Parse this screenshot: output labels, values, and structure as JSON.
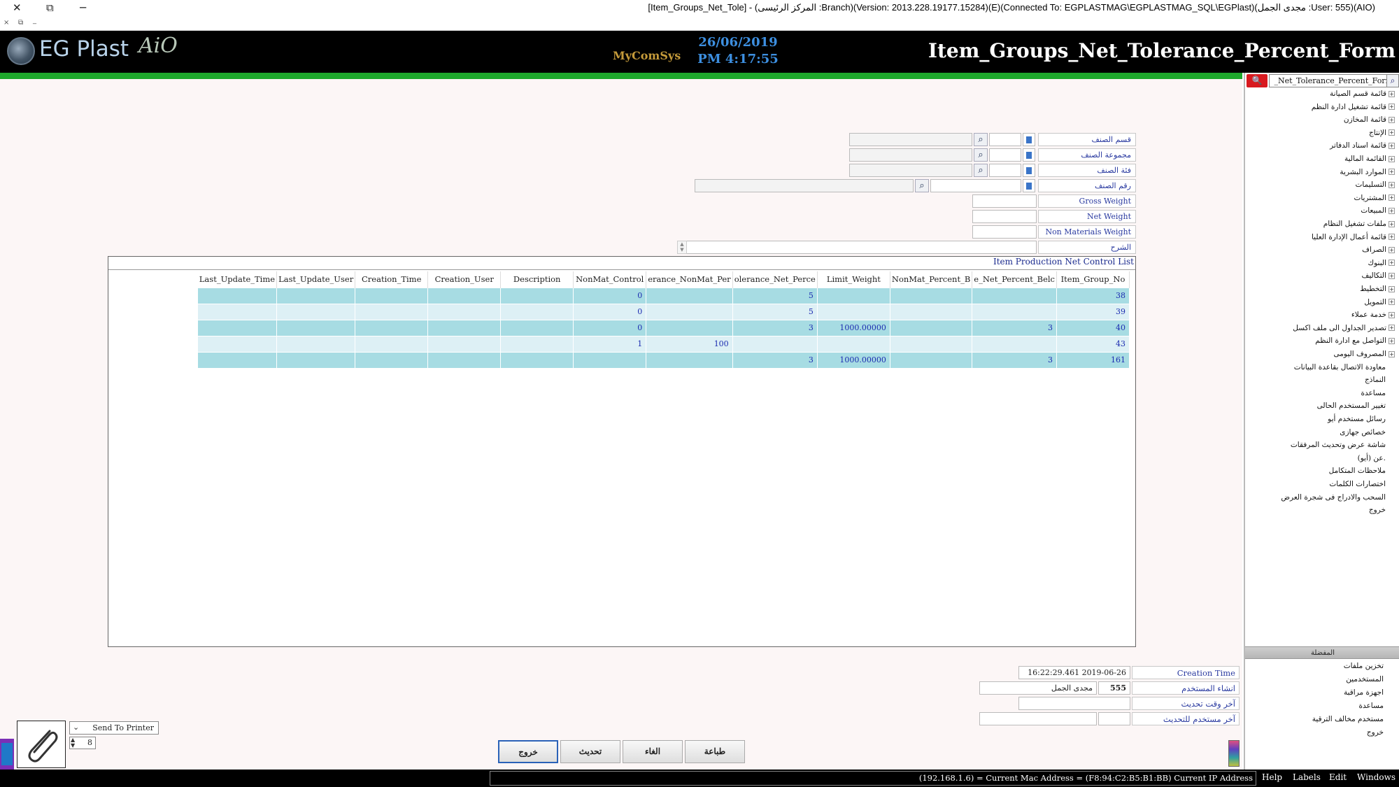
{
  "window": {
    "title": "[Item_Groups_Net_Tole] - (المركز الرئيسى :Branch)(Version: 2013.228.19177.15284)(E)(Connected To: EGPLASTMAG\\EGPLASTMAG_SQL\\EGPlast)(مجدى الجمل :User: 555)(AIO)",
    "close_glyph": "✕",
    "restore_glyph": "⧉",
    "minimize_glyph": "─",
    "sub_close": "×",
    "sub_restore": "⧉",
    "sub_minimize": "_"
  },
  "header": {
    "logo_text": "EG Plast",
    "logo_suffix": "AiO",
    "partner_logo": "MyComSys",
    "date": "26/06/2019",
    "time": "PM 4:17:55",
    "form_title": "Item_Groups_Net_Tolerance_Percent_Form"
  },
  "filters": {
    "section_label": "قسم الصنف",
    "group_label": "مجموعة الصنف",
    "category_label": "فئة الصنف",
    "item_no_label": "رقم الصنف",
    "gross_weight_label": "Gross Weight",
    "net_weight_label": "Net Weight",
    "non_materials_weight_label": "Non Materials Weight",
    "description_label": "الشرح",
    "pick_glyph": "ا",
    "search_glyph": "⌕"
  },
  "grid": {
    "title": "Item Production Net Control List",
    "columns": [
      "Last_Update_Time",
      "Last_Update_User",
      "Creation_Time",
      "Creation_User",
      "Description",
      "NonMat_Control",
      "erance_NonMat_Per",
      "olerance_Net_Perce",
      "Limit_Weight",
      "NonMat_Percent_B",
      "e_Net_Percent_Belc",
      "Item_Group_No"
    ],
    "rows": [
      [
        "",
        "",
        "",
        "",
        "",
        "0",
        "",
        "5",
        "",
        "",
        "",
        "38"
      ],
      [
        "",
        "",
        "",
        "",
        "",
        "0",
        "",
        "5",
        "",
        "",
        "",
        "39"
      ],
      [
        "",
        "",
        "",
        "",
        "",
        "0",
        "",
        "3",
        "1000.00000",
        "",
        "3",
        "40"
      ],
      [
        "",
        "",
        "",
        "",
        "",
        "1",
        "100",
        "",
        "",
        "",
        "",
        "43"
      ],
      [
        "",
        "",
        "",
        "",
        "",
        "",
        "",
        "3",
        "1000.00000",
        "",
        "3",
        "161"
      ]
    ]
  },
  "record_info": {
    "creation_time_label": "Creation Time",
    "creation_time_value": "16:22:29.461 2019-06-26",
    "created_by_label": "انشاء المستخدم",
    "created_by_id": "555",
    "created_by_name": "مجدى الجمل",
    "last_update_time_label": "آخر وقت تحديث",
    "last_update_user_label": "آخر مستخدم للتحديث"
  },
  "buttons": {
    "exit": "خروج",
    "refresh": "تحديث",
    "cancel": "الغاء",
    "print": "طباعة"
  },
  "printer": {
    "mode": "Send To Printer",
    "copies": "8"
  },
  "sidebar": {
    "search_value": "_Net_Tolerance_Percent_Form",
    "search_btn_glyph": "🔍",
    "tree": [
      {
        "label": "قائمة قسم الصيانة",
        "expandable": true
      },
      {
        "label": "قائمة تشغيل ادارة النظم",
        "expandable": true
      },
      {
        "label": "قائمة المخازن",
        "expandable": true
      },
      {
        "label": "الإنتاج",
        "expandable": true
      },
      {
        "label": "قائمة اسناد الدفاتر",
        "expandable": true
      },
      {
        "label": "القائمة المالية",
        "expandable": true
      },
      {
        "label": "الموارد البشرية",
        "expandable": true
      },
      {
        "label": "التسليمات",
        "expandable": true
      },
      {
        "label": "المشتريات",
        "expandable": true
      },
      {
        "label": "المبيعات",
        "expandable": true
      },
      {
        "label": "ملفات تشغيل النظام",
        "expandable": true
      },
      {
        "label": "قائمة أعمال الإدارة العليا",
        "expandable": true
      },
      {
        "label": "الصراف",
        "expandable": true
      },
      {
        "label": "البنوك",
        "expandable": true
      },
      {
        "label": "التكاليف",
        "expandable": true
      },
      {
        "label": "التخطيط",
        "expandable": true
      },
      {
        "label": "التمويل",
        "expandable": true
      },
      {
        "label": "خدمة عملاء",
        "expandable": true
      },
      {
        "label": "تصدير الجداول الى ملف اكسل",
        "expandable": true
      },
      {
        "label": "التواصل مع ادارة النظم",
        "expandable": true
      },
      {
        "label": "المصروف اليومى",
        "expandable": true
      },
      {
        "label": "معاودة الاتصال بقاعدة البيانات",
        "expandable": false
      },
      {
        "label": "النماذج",
        "expandable": false
      },
      {
        "label": "مساعدة",
        "expandable": false
      },
      {
        "label": "تغيير المستخدم الحالى",
        "expandable": false
      },
      {
        "label": "رسائل مستخدم أيو",
        "expandable": false
      },
      {
        "label": "خصائص جهازى",
        "expandable": false
      },
      {
        "label": "شاشة عرض وتحديث المرفقات",
        "expandable": false
      },
      {
        "label": "عن (أيو).",
        "expandable": false
      },
      {
        "label": "ملاحظات المتكامل",
        "expandable": false
      },
      {
        "label": "اختصارات الكلمات",
        "expandable": false
      },
      {
        "label": "السحب والادراج فى شجرة العرض",
        "expandable": false
      },
      {
        "label": "خروج",
        "expandable": false
      }
    ],
    "favorites_title": "المفضلة",
    "favorites": [
      "تخزين ملفات",
      "المستخدمين",
      "اجهزة مراقبة",
      "مساعدة",
      "مستخدم مخالف الترقية",
      "خروج"
    ]
  },
  "statusbar": {
    "network": "(192.168.1.6) = Current Mac Address = (F8:94:C2:B5:B1:BB) Current IP Address",
    "menu": [
      "Help",
      "Labels",
      "Edit",
      "Windows"
    ]
  },
  "colors": {
    "accent_green": "#1ea82c",
    "row_dark": "#a7dce3",
    "row_light": "#ddf0f5",
    "header_bg": "#000000",
    "date_blue": "#3d8fe0",
    "search_red": "#d8191f"
  }
}
